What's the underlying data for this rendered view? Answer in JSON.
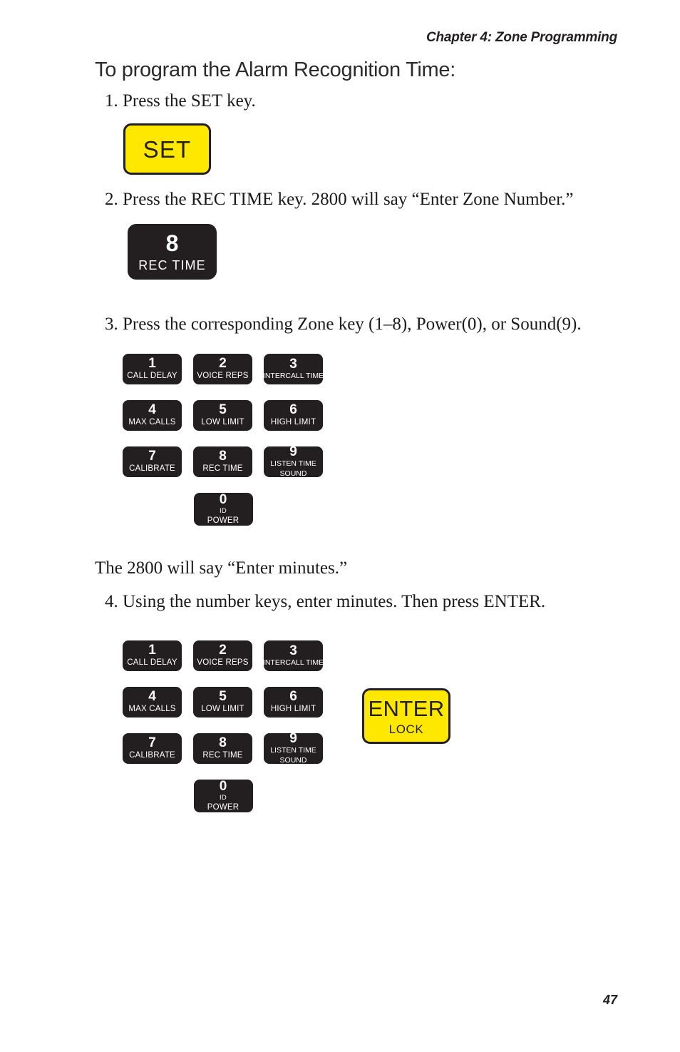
{
  "header": {
    "chapter": "Chapter 4: Zone Programming"
  },
  "section": {
    "title": "To program the Alarm Recognition Time:"
  },
  "steps": {
    "step1": "1. Press the SET key.",
    "step2": "2. Press the REC TIME key. 2800 will say “Enter Zone Number.”",
    "step3": "3. Press the corresponding Zone key (1–8), Power(0), or Sound(9).",
    "interstitial": "The 2800 will say “Enter minutes.”",
    "step4": "4. Using the number keys, enter minutes. Then press ENTER."
  },
  "keys": {
    "set": {
      "cap": "SET",
      "color": "#ffe800",
      "text_color": "#231f20"
    },
    "enter": {
      "cap": "ENTER",
      "sub": "LOCK",
      "color": "#ffe800",
      "text_color": "#231f20"
    },
    "rec_time_large": {
      "digit": "8",
      "label": "REC TIME",
      "color": "#231f20",
      "text_color": "#ffffff"
    }
  },
  "keypad": {
    "key_color": "#231f20",
    "key_text_color": "#ffffff",
    "rows": [
      [
        {
          "digit": "1",
          "label": "CALL DELAY",
          "label2": ""
        },
        {
          "digit": "2",
          "label": "VOICE REPS",
          "label2": ""
        },
        {
          "digit": "3",
          "label": "INTERCALL TIME",
          "label2": ""
        }
      ],
      [
        {
          "digit": "4",
          "label": "MAX CALLS",
          "label2": ""
        },
        {
          "digit": "5",
          "label": "LOW LIMIT",
          "label2": ""
        },
        {
          "digit": "6",
          "label": "HIGH LIMIT",
          "label2": ""
        }
      ],
      [
        {
          "digit": "7",
          "label": "CALIBRATE",
          "label2": ""
        },
        {
          "digit": "8",
          "label": "REC TIME",
          "label2": ""
        },
        {
          "digit": "9",
          "label": "LISTEN TIME",
          "label2": "SOUND"
        }
      ]
    ],
    "zero": {
      "digit": "0",
      "label": "ID",
      "label2": "POWER"
    }
  },
  "folio": {
    "page_number": "47"
  }
}
